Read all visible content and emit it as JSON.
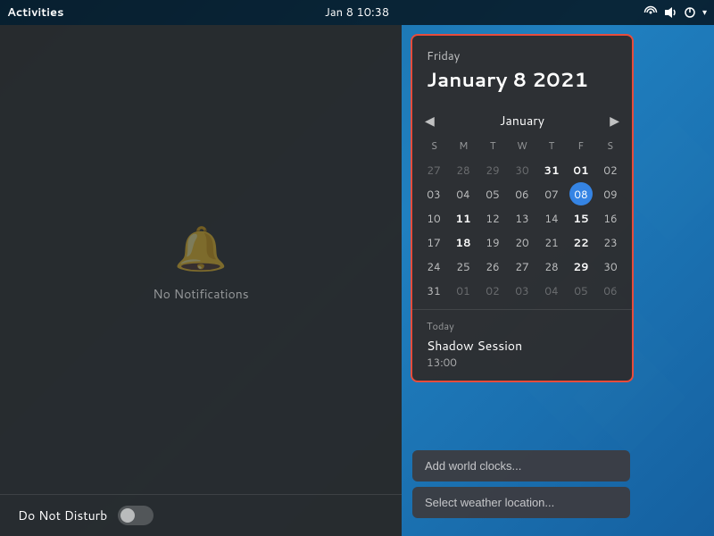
{
  "topbar": {
    "activities_label": "Activities",
    "datetime": "Jan 8  10:38"
  },
  "notification_panel": {
    "no_notifications_text": "No Notifications",
    "do_not_disturb_label": "Do Not Disturb"
  },
  "calendar": {
    "day_label": "Friday",
    "full_date": "January 8 2021",
    "month_label": "January",
    "prev_icon": "◀",
    "next_icon": "▶",
    "weekdays": [
      "S",
      "M",
      "T",
      "W",
      "T",
      "F",
      "S"
    ],
    "rows": [
      [
        {
          "day": "27",
          "other": true
        },
        {
          "day": "28",
          "other": true
        },
        {
          "day": "29",
          "other": true
        },
        {
          "day": "30",
          "other": true
        },
        {
          "day": "31",
          "bold": true
        },
        {
          "day": "01",
          "bold": true
        },
        {
          "day": "02",
          "other": false
        }
      ],
      [
        {
          "day": "03"
        },
        {
          "day": "04"
        },
        {
          "day": "05"
        },
        {
          "day": "06"
        },
        {
          "day": "07"
        },
        {
          "day": "08",
          "today": true
        },
        {
          "day": "09"
        }
      ],
      [
        {
          "day": "10"
        },
        {
          "day": "11",
          "bold": true
        },
        {
          "day": "12"
        },
        {
          "day": "13"
        },
        {
          "day": "14"
        },
        {
          "day": "15",
          "bold": true
        },
        {
          "day": "16"
        }
      ],
      [
        {
          "day": "17"
        },
        {
          "day": "18",
          "bold": true
        },
        {
          "day": "19"
        },
        {
          "day": "20"
        },
        {
          "day": "21"
        },
        {
          "day": "22",
          "bold": true
        },
        {
          "day": "23"
        }
      ],
      [
        {
          "day": "24"
        },
        {
          "day": "25"
        },
        {
          "day": "26"
        },
        {
          "day": "27"
        },
        {
          "day": "28"
        },
        {
          "day": "29",
          "bold": true
        },
        {
          "day": "30"
        }
      ],
      [
        {
          "day": "31"
        },
        {
          "day": "01",
          "other": true
        },
        {
          "day": "02",
          "other": true
        },
        {
          "day": "03",
          "other": true
        },
        {
          "day": "04",
          "other": true
        },
        {
          "day": "05",
          "other": true
        },
        {
          "day": "06",
          "other": true
        }
      ]
    ],
    "events_label": "Today",
    "event_title": "Shadow Session",
    "event_time": "13:00"
  },
  "buttons": {
    "world_clocks": "Add world clocks...",
    "weather_location": "Select weather location..."
  }
}
